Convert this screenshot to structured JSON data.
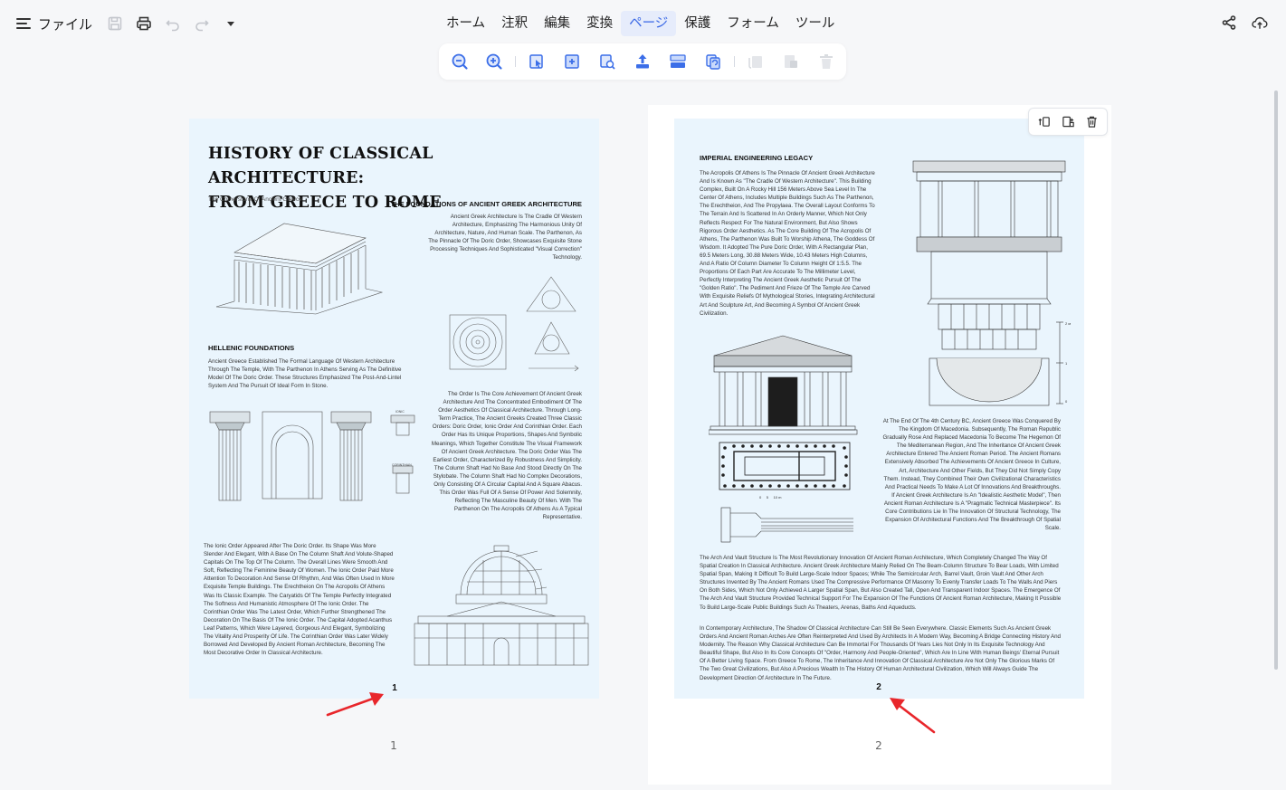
{
  "menu": {
    "label": "ファイル"
  },
  "tabs": [
    {
      "label": "ホーム",
      "active": false
    },
    {
      "label": "注釈",
      "active": false
    },
    {
      "label": "編集",
      "active": false
    },
    {
      "label": "変換",
      "active": false
    },
    {
      "label": "ページ",
      "active": true
    },
    {
      "label": "保護",
      "active": false
    },
    {
      "label": "フォーム",
      "active": false
    },
    {
      "label": "ツール",
      "active": false
    }
  ],
  "colors": {
    "accent": "#3a68e6",
    "tool_blue": "#3b6ee8",
    "page_bg": "#eaf5fd",
    "arrow": "#e8262b"
  },
  "page1": {
    "title_line1": "HISTORY OF CLASSICAL  ARCHITECTURE:",
    "title_line2": "FROM GREECE TO ROME",
    "subtitle": "The Cornerstone Of Ancient Greece",
    "foundations_heading": "THE FOUNDATIONS OF ANCIENT GREEK ARCHITECTURE",
    "foundations_text": "Ancient Greek Architecture Is The Cradle Of Western Architecture, Emphasizing The Harmonious Unity Of Architecture, Nature, And Human Scale. The Parthenon, As The Pinnacle Of The Doric Order, Showcases Exquisite Stone Processing Techniques And Sophisticated \"Visual Correction\" Technology.",
    "hellenic_heading": "HELLENIC FOUNDATIONS",
    "hellenic_text": "Ancient Greece Established The Formal Language Of Western Architecture Through The Temple, With The Parthenon In Athens Serving As The Definitive Model Of The Doric Order. These Structures Emphasized The Post-And-Lintel System And The Pursuit Of Ideal Form In Stone.",
    "order_text": "The Order Is The Core Achievement Of Ancient Greek Architecture And The Concentrated Embodiment Of The Order Aesthetics Of Classical Architecture. Through Long-Term Practice, The Ancient Greeks Created Three Classic Orders: Doric Order, Ionic Order And Corinthian Order. Each Order Has Its Unique Proportions, Shapes And Symbolic Meanings, Which Together Constitute The Visual Framework Of Ancient Greek Architecture. The Doric Order Was The Earliest Order, Characterized By Robustness And Simplicity. The Column Shaft Had No Base And Stood Directly On The Stylobate. The Column Shaft Had No Complex Decorations, Only Consisting Of A Circular Capital And A Square Abacus. This Order Was Full Of A Sense Of Power And Solemnity, Reflecting The Masculine Beauty Of Men. With The Parthenon On The Acropolis Of Athens As A Typical Representative.",
    "ionic_text": "The Ionic Order Appeared After The Doric Order. Its Shape Was More Slender And Elegant, With A Base On The Column Shaft And Volute-Shaped Capitals On The Top Of The Column. The Overall Lines Were Smooth And Soft, Reflecting The Feminine Beauty Of Women. The Ionic Order Paid More Attention To Decoration And Sense Of Rhythm, And Was Often Used In More Exquisite Temple Buildings. The Erechtheion On The Acropolis Of Athens Was Its Classic Example. The Caryatids Of The Temple Perfectly Integrated The Softness And Humanistic Atmosphere Of The Ionic Order. The Corinthian Order Was The Latest Order, Which Further Strengthened The Decoration On The Basis Of The Ionic Order. The Capital Adopted Acanthus Leaf Patterns, Which Were Layered, Gorgeous And Elegant, Symbolizing The Vitality And Prosperity Of Life. The Corinthian Order Was Later Widely Borrowed And Developed By Ancient Roman Architecture, Becoming The Most Decorative Order In Classical Architecture.",
    "ionic_label": "IONIC",
    "corinthian_label": "CORINTHIAN",
    "page_number": "1"
  },
  "page2": {
    "heading": "IMPERIAL ENGINEERING LEGACY",
    "acropolis_text": "The Acropolis Of Athens Is The Pinnacle Of Ancient Greek Architecture And Is Known As \"The Cradle Of Western Architecture\". This Building Complex, Built On A Rocky Hill 156 Meters Above Sea Level In The Center Of Athens, Includes Multiple Buildings Such As The Parthenon, The Erechtheion, And The Propylaea. The Overall Layout Conforms To The Terrain And Is Scattered In An Orderly Manner, Which Not Only Reflects Respect For The Natural Environment, But Also Shows Rigorous Order Aesthetics. As The Core Building Of The Acropolis Of Athens, The Parthenon Was Built To Worship Athena, The Goddess Of Wisdom. It Adopted The Pure Doric Order, With A Rectangular Plan, 69.5 Meters Long, 30.88 Meters Wide, 10.43 Meters High Columns, And A Ratio Of Column Diameter To Column Height Of 1:5.5. The Proportions Of Each Part Are Accurate To The Millimeter Level, Perfectly Interpreting The Ancient Greek Aesthetic Pursuit Of The \"Golden Ratio\". The Pediment And Frieze Of The Temple Are Carved With Exquisite Reliefs Of Mythological Stories, Integrating Architectural Art And Sculpture Art, And Becoming A Symbol Of Ancient Greek Civilization.",
    "macedonia_text": "At The End Of The 4th Century BC, Ancient Greece Was Conquered By The Kingdom Of Macedonia. Subsequently, The Roman Republic Gradually Rose And Replaced Macedonia To Become The Hegemon Of The Mediterranean Region, And The Inheritance Of Ancient Greek Architecture Entered The Ancient Roman Period. The Ancient Romans Extensively Absorbed The Achievements Of Ancient Greece In Culture, Art, Architecture And Other Fields, But They Did Not Simply Copy Them. Instead, They Combined Their Own Civilizational Characteristics And Practical Needs To Make A Lot Of Innovations And Breakthroughs. If Ancient Greek Architecture Is An \"Idealistic Aesthetic Model\", Then Ancient Roman Architecture Is A \"Pragmatic Technical Masterpiece\". Its Core Contributions Lie In The Innovation Of Structural Technology, The Expansion Of Architectural Functions And The Breakthrough Of Spatial Scale.",
    "arch_text": "The Arch And Vault Structure Is The Most Revolutionary Innovation Of Ancient Roman Architecture, Which Completely Changed The Way Of Spatial Creation In Classical Architecture. Ancient Greek Architecture Mainly Relied On The Beam-Column Structure To Bear Loads, With Limited Spatial Span, Making It Difficult To Build Large-Scale Indoor Spaces; While The Semicircular Arch, Barrel Vault, Groin Vault And Other Arch Structures Invented By The Ancient Romans Used The Compressive Performance Of Masonry To Evenly Transfer Loads To The Walls And Piers On Both Sides, Which Not Only Achieved A Larger Spatial Span, But Also Created Tall, Open And Transparent Indoor Spaces. The Emergence Of The Arch And Vault Structure Provided Technical Support For The Expansion Of The Functions Of Ancient Roman Architecture, Making It Possible To Build Large-Scale Public Buildings Such As Theaters, Arenas, Baths And Aqueducts.",
    "contemporary_text": "In Contemporary Architecture, The Shadow Of Classical Architecture Can Still Be Seen Everywhere. Classic Elements Such As Ancient Greek Orders And Ancient Roman Arches Are Often Reinterpreted And Used By Architects In A Modern Way, Becoming A Bridge Connecting History And Modernity. The Reason Why Classical Architecture Can Be Immortal For Thousands Of Years Lies Not Only In Its Exquisite Technology And Beautiful Shape, But Also In Its Core Concepts Of \"Order, Harmony And People-Oriented\", Which Are In Line With Human Beings' Eternal Pursuit Of A Better Living Space. From Greece To Rome, The Inheritance And Innovation Of Classical Architecture Are Not Only The Glorious Marks Of The Two Great Civilizations, But Also A Precious Wealth In The History Of Human Architectural Civilization, Which Will Always Guide The Development Direction Of Architecture In The Future.",
    "scale_label": "0     5     10 m",
    "scale_2m": "2 м",
    "scale_1": "1",
    "scale_0": "0",
    "page_number": "2"
  },
  "thumb_labels": {
    "p1": "1",
    "p2": "2"
  },
  "icons": {
    "left": [
      "save-icon",
      "print-icon",
      "undo-icon",
      "redo-icon",
      "dropdown-icon"
    ],
    "right": [
      "share-icon",
      "cloud-upload-icon"
    ],
    "toolbar": [
      "zoom-out-icon",
      "zoom-in-icon",
      "select-page-icon",
      "insert-page-icon",
      "extract-page-icon",
      "export-page-icon",
      "split-page-icon",
      "replace-page-icon",
      "rotate-left-icon",
      "rotate-right-icon",
      "delete-page-icon"
    ],
    "page_float": [
      "rotate-page-icon",
      "insert-after-icon",
      "trash-icon"
    ]
  }
}
